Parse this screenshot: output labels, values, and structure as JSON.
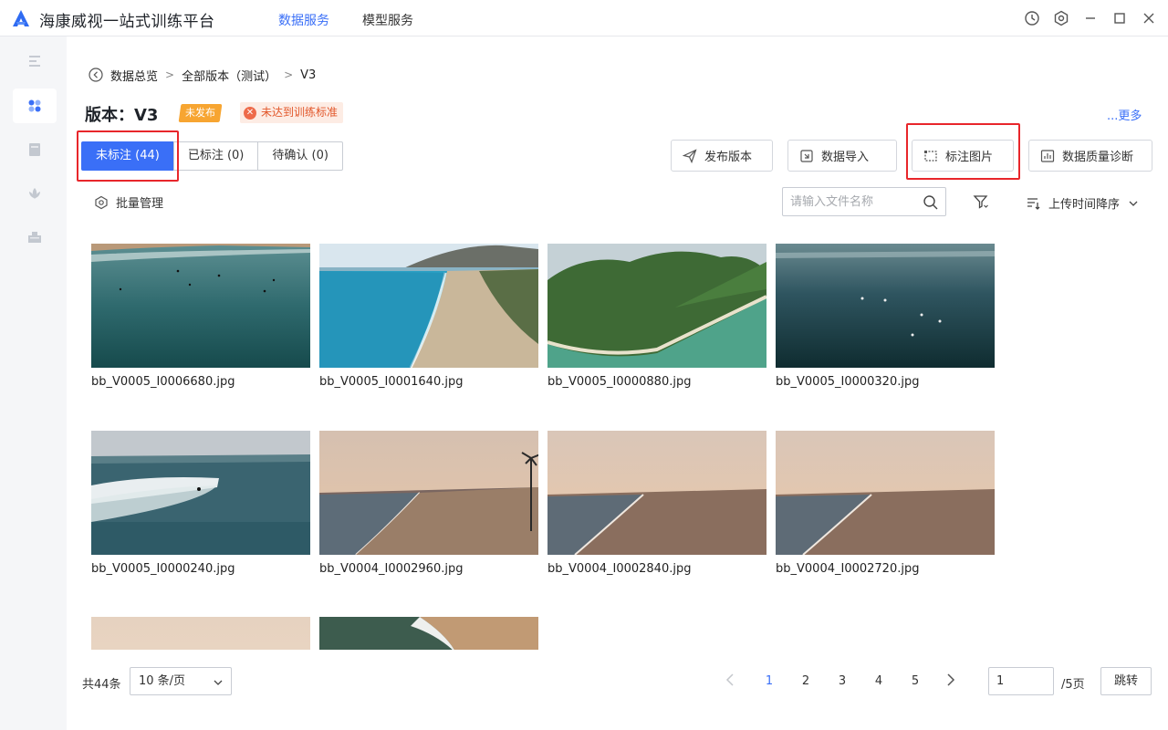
{
  "app": {
    "title": "海康威视一站式训练平台",
    "nav": [
      "数据服务",
      "模型服务"
    ],
    "active_nav": "数据服务",
    "window_controls": [
      "history-icon",
      "settings-icon",
      "minimize-icon",
      "maximize-icon",
      "close-icon"
    ]
  },
  "sidebar": {
    "items": [
      {
        "icon": "menu-icon",
        "active": false
      },
      {
        "icon": "dataset-icon",
        "active": true
      },
      {
        "icon": "document-icon",
        "active": false
      },
      {
        "icon": "model-icon",
        "active": false
      },
      {
        "icon": "deploy-icon",
        "active": false
      }
    ]
  },
  "breadcrumb": {
    "items": [
      "数据总览",
      "全部版本（测试）",
      "V3"
    ],
    "separator": ">"
  },
  "version": {
    "title": "版本：V3",
    "status_badge": "未发布",
    "warning_badge": "未达到训练标准",
    "more_link": "...更多"
  },
  "tabs": [
    {
      "label": "未标注 (44)",
      "active": true
    },
    {
      "label": "已标注 (0)",
      "active": false
    },
    {
      "label": "待确认 (0)",
      "active": false
    }
  ],
  "actions": {
    "publish": "发布版本",
    "import": "数据导入",
    "annotate": "标注图片",
    "quality": "数据质量诊断"
  },
  "toolbar": {
    "batch": "批量管理",
    "search_placeholder": "请输入文件名称",
    "sort": "上传时间降序"
  },
  "images": [
    {
      "name": "bb_V0005_I0006680.jpg",
      "scene": "ocean-surfers"
    },
    {
      "name": "bb_V0005_I0001640.jpg",
      "scene": "coast-town"
    },
    {
      "name": "bb_V0005_I0000880.jpg",
      "scene": "tropical-island"
    },
    {
      "name": "bb_V0005_I0000320.jpg",
      "scene": "dark-ocean"
    },
    {
      "name": "bb_V0005_I0000240.jpg",
      "scene": "wave-surfer"
    },
    {
      "name": "bb_V0004_I0002960.jpg",
      "scene": "sunset-beach-palms"
    },
    {
      "name": "bb_V0004_I0002840.jpg",
      "scene": "sunset-beach"
    },
    {
      "name": "bb_V0004_I0002720.jpg",
      "scene": "sunset-beach"
    },
    {
      "name": "",
      "scene": "hazy-sky"
    },
    {
      "name": "",
      "scene": "aerial-shore"
    }
  ],
  "pagination": {
    "total": "共44条",
    "page_size": "10 条/页",
    "pages": [
      "1",
      "2",
      "3",
      "4",
      "5"
    ],
    "current": "1",
    "jump_value": "1",
    "total_pages": "/5页",
    "jump_label": "跳转"
  },
  "colors": {
    "accent": "#3a6ff7",
    "highlight": "#e8262b",
    "warning": "#e2572a",
    "badge_orange": "#f7a531"
  }
}
